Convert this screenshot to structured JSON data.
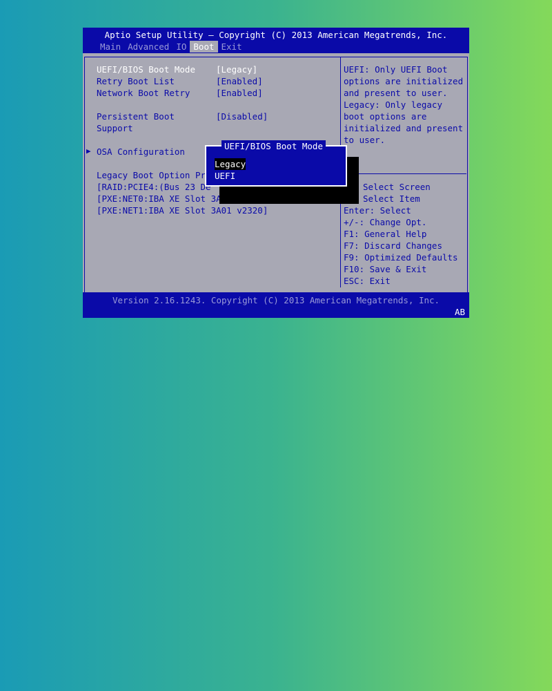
{
  "header": {
    "title": "Aptio Setup Utility – Copyright (C) 2013 American Megatrends, Inc.",
    "tabs": [
      "Main",
      "Advanced",
      "IO",
      "Boot",
      "Exit"
    ],
    "active_tab": "Boot"
  },
  "settings": [
    {
      "label": "UEFI/BIOS Boot Mode",
      "value": "[Legacy]"
    },
    {
      "label": "Retry Boot List",
      "value": "[Enabled]"
    },
    {
      "label": "Network Boot Retry",
      "value": "[Enabled]"
    },
    {
      "label": "Persistent Boot",
      "label2": "Support",
      "value": "[Disabled]"
    },
    {
      "label": "OSA Configuration"
    }
  ],
  "boot_order": {
    "heading": "Legacy Boot Option Pri",
    "items": [
      "[RAID:PCIE4:(Bus 23 De",
      "[PXE:NET0:IBA XE Slot 3A",
      "[PXE:NET1:IBA XE Slot 3A01 v2320]"
    ]
  },
  "help_text": [
    "UEFI: Only UEFI Boot",
    "options are initialized",
    "and present to user.",
    "Legacy: Only legacy",
    "boot options are",
    "initialized and present",
    "to user."
  ],
  "key_help": [
    "Select Screen",
    "Select Item",
    "Enter: Select",
    "+/-: Change Opt.",
    "F1: General Help",
    "F7: Discard Changes",
    "F9: Optimized Defaults",
    "F10: Save & Exit",
    "ESC: Exit"
  ],
  "popup": {
    "title": "UEFI/BIOS Boot Mode",
    "options": [
      "Legacy",
      "UEFI"
    ],
    "selected": "Legacy"
  },
  "footer": {
    "version": "Version 2.16.1243. Copyright (C) 2013 American Megatrends, Inc.",
    "badge": "AB"
  },
  "icons": {
    "submenu_arrow": "right-triangle-icon"
  },
  "colors": {
    "bios_blue": "#0a0aa8",
    "bios_gray": "#a8a8b4"
  }
}
